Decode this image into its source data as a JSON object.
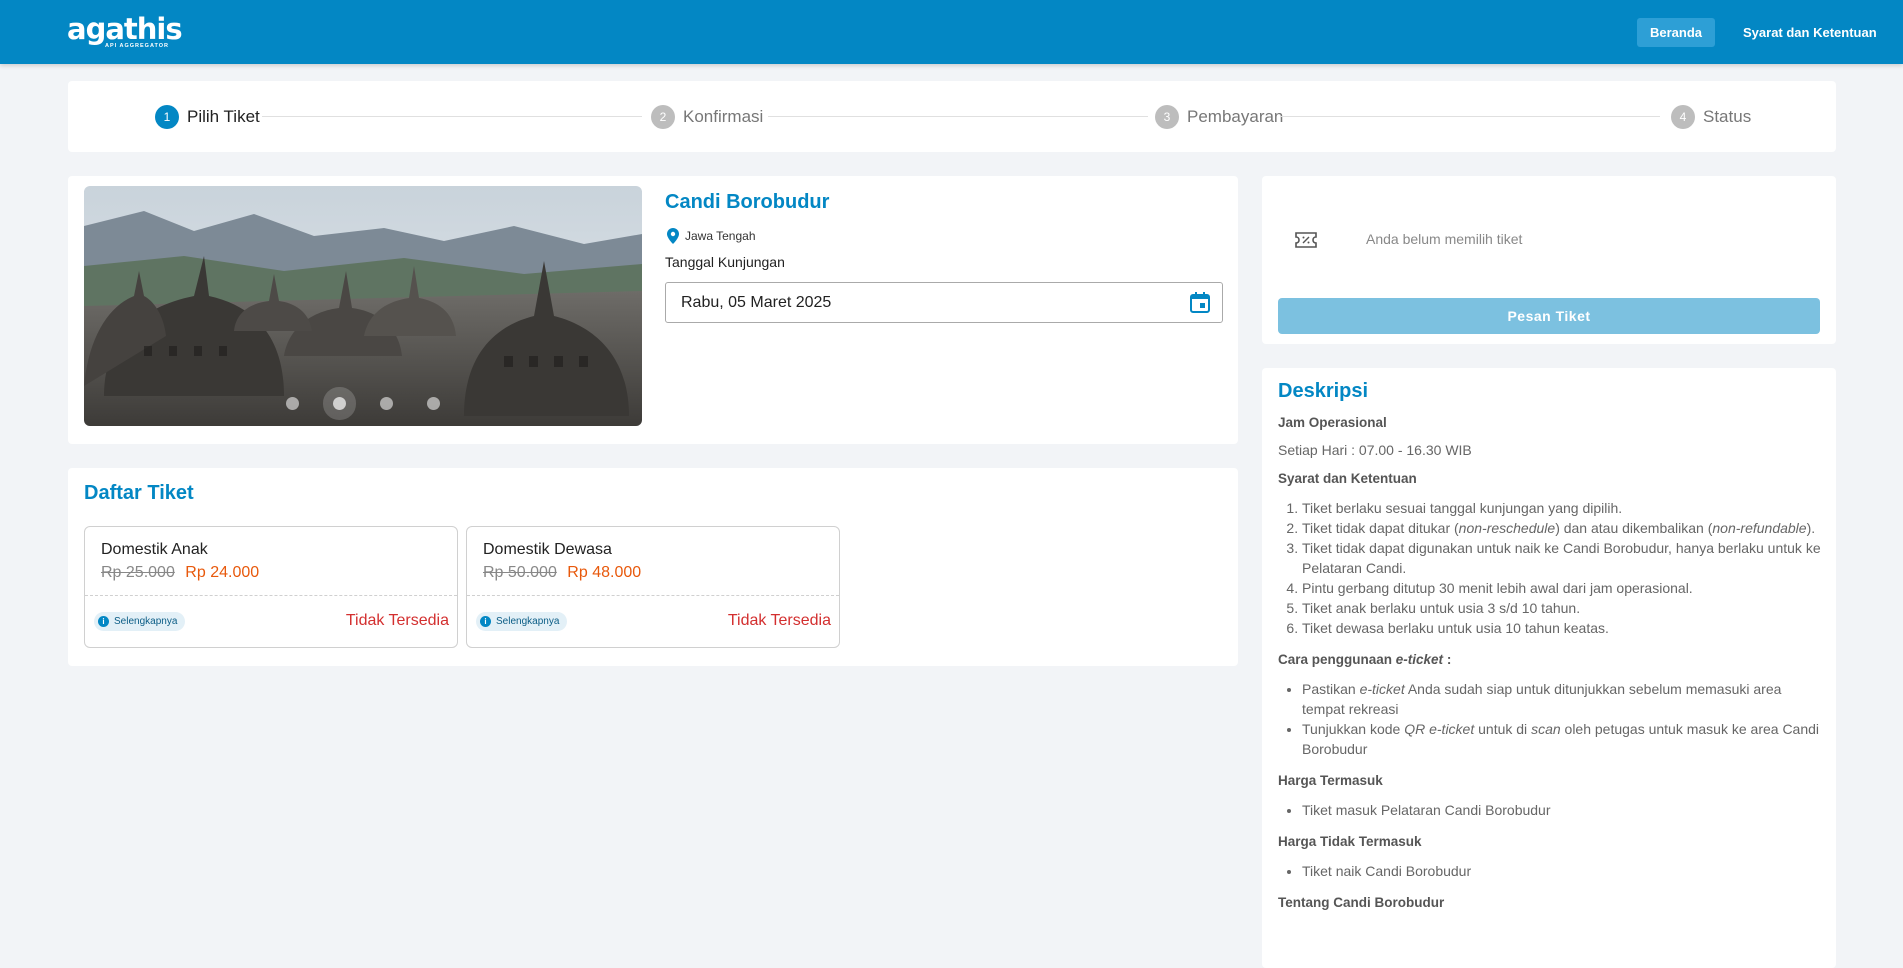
{
  "header": {
    "logo_text": "agathis",
    "logo_tagline": "API AGGREGATOR",
    "nav_home": "Beranda",
    "nav_terms": "Syarat dan Ketentuan"
  },
  "stepper": {
    "steps": [
      {
        "num": "1",
        "label": "Pilih Tiket"
      },
      {
        "num": "2",
        "label": "Konfirmasi"
      },
      {
        "num": "3",
        "label": "Pembayaran"
      },
      {
        "num": "4",
        "label": "Status"
      }
    ],
    "active_step": 1
  },
  "product": {
    "title": "Candi Borobudur",
    "location": "Jawa Tengah",
    "visit_label": "Tanggal Kunjungan",
    "visit_date": "Rabu, 05 Maret 2025",
    "carousel_count": 4,
    "carousel_active": 2
  },
  "tickets": {
    "title": "Daftar Tiket",
    "items": [
      {
        "name": "Domestik Anak",
        "old_price": "Rp 25.000",
        "price": "Rp 24.000",
        "more_label": "Selengkapnya",
        "status": "Tidak Tersedia"
      },
      {
        "name": "Domestik Dewasa",
        "old_price": "Rp 50.000",
        "price": "Rp 48.000",
        "more_label": "Selengkapnya",
        "status": "Tidak Tersedia"
      }
    ]
  },
  "order": {
    "empty_text": "Anda belum memilih tiket",
    "button_label": "Pesan Tiket"
  },
  "description": {
    "title": "Deskripsi",
    "hours_heading": "Jam Operasional",
    "hours_text": "Setiap Hari : 07.00 - 16.30 WIB",
    "terms_heading": "Syarat dan Ketentuan",
    "terms": {
      "t1": "Tiket berlaku sesuai tanggal kunjungan yang dipilih.",
      "t2_a": "Tiket tidak dapat ditukar (",
      "t2_b": "non-reschedule",
      "t2_c": ") dan atau dikembalikan (",
      "t2_d": "non-refundable",
      "t2_e": ").",
      "t3": "Tiket tidak dapat digunakan untuk naik ke Candi Borobudur, hanya berlaku untuk ke Pelataran Candi.",
      "t4": "Pintu gerbang ditutup 30 menit lebih awal dari jam operasional.",
      "t5": "Tiket anak berlaku untuk usia 3 s/d 10 tahun.",
      "t6": "Tiket dewasa berlaku untuk usia 10 tahun keatas."
    },
    "usage_heading_a": "Cara penggunaan ",
    "usage_heading_b": "e-ticket",
    "usage_heading_c": " :",
    "usage": {
      "u1_a": "Pastikan ",
      "u1_b": "e-ticket",
      "u1_c": " Anda sudah siap untuk ditunjukkan sebelum memasuki area tempat rekreasi",
      "u2_a": "Tunjukkan kode ",
      "u2_b": "QR e-ticket",
      "u2_c": " untuk di ",
      "u2_d": "scan",
      "u2_e": " oleh petugas untuk masuk ke area Candi Borobudur"
    },
    "includes_heading": "Harga Termasuk",
    "includes": [
      "Tiket masuk Pelataran Candi Borobudur"
    ],
    "excludes_heading": "Harga Tidak Termasuk",
    "excludes": [
      "Tiket naik Candi Borobudur"
    ],
    "about_heading": "Tentang Candi Borobudur"
  },
  "colors": {
    "primary": "#0387c4",
    "price": "#e8590c",
    "unavailable": "#d32f2f",
    "button_disabled": "#7cc1e0"
  }
}
